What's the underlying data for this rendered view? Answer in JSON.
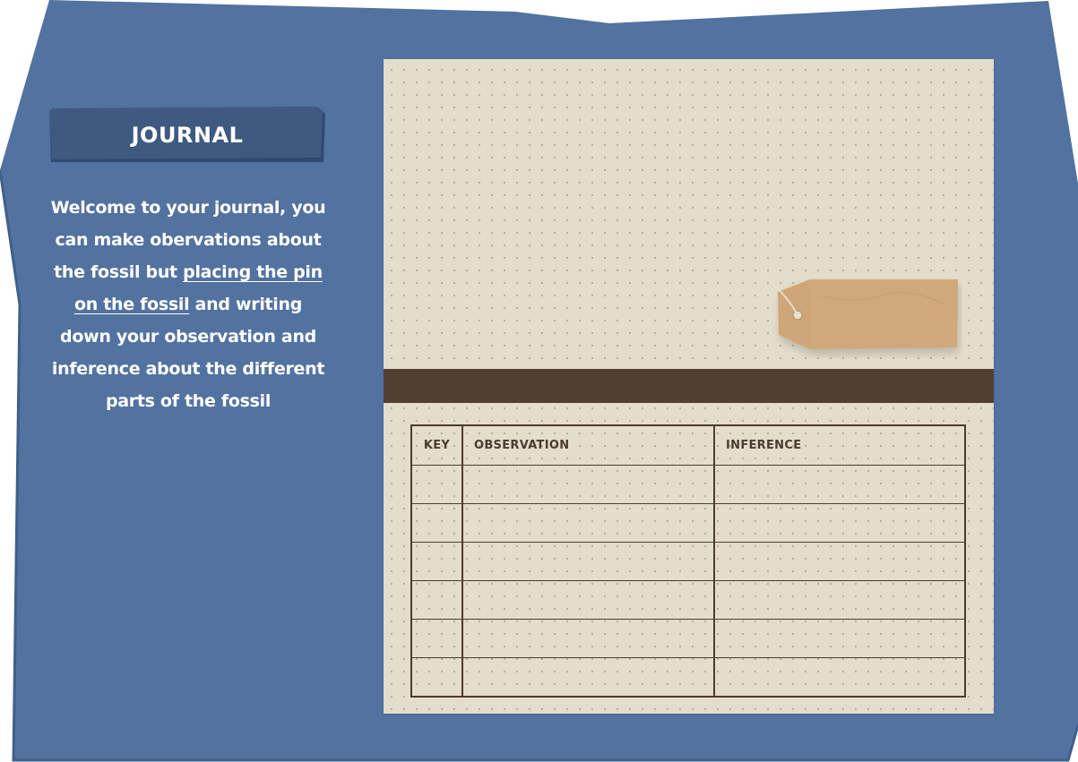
{
  "panel": {
    "color": "#5272a0",
    "title": "JOURNAL",
    "intro": {
      "before": "Welcome to your journal, you can make obervations about the fossil but ",
      "link": "placing the pin on the fossil",
      "after": " and writing down your observation and inference about the different parts of the fossil"
    }
  },
  "journal": {
    "paper_color": "#e4ddcc",
    "divider_color": "#523f33",
    "tag_icon": "paper-tag-icon",
    "table": {
      "columns": [
        "KEY",
        "OBSERVATION",
        "INFERENCE"
      ],
      "rows": [
        [
          "",
          "",
          ""
        ],
        [
          "",
          "",
          ""
        ],
        [
          "",
          "",
          ""
        ],
        [
          "",
          "",
          ""
        ],
        [
          "",
          "",
          ""
        ],
        [
          "",
          "",
          ""
        ]
      ]
    }
  }
}
